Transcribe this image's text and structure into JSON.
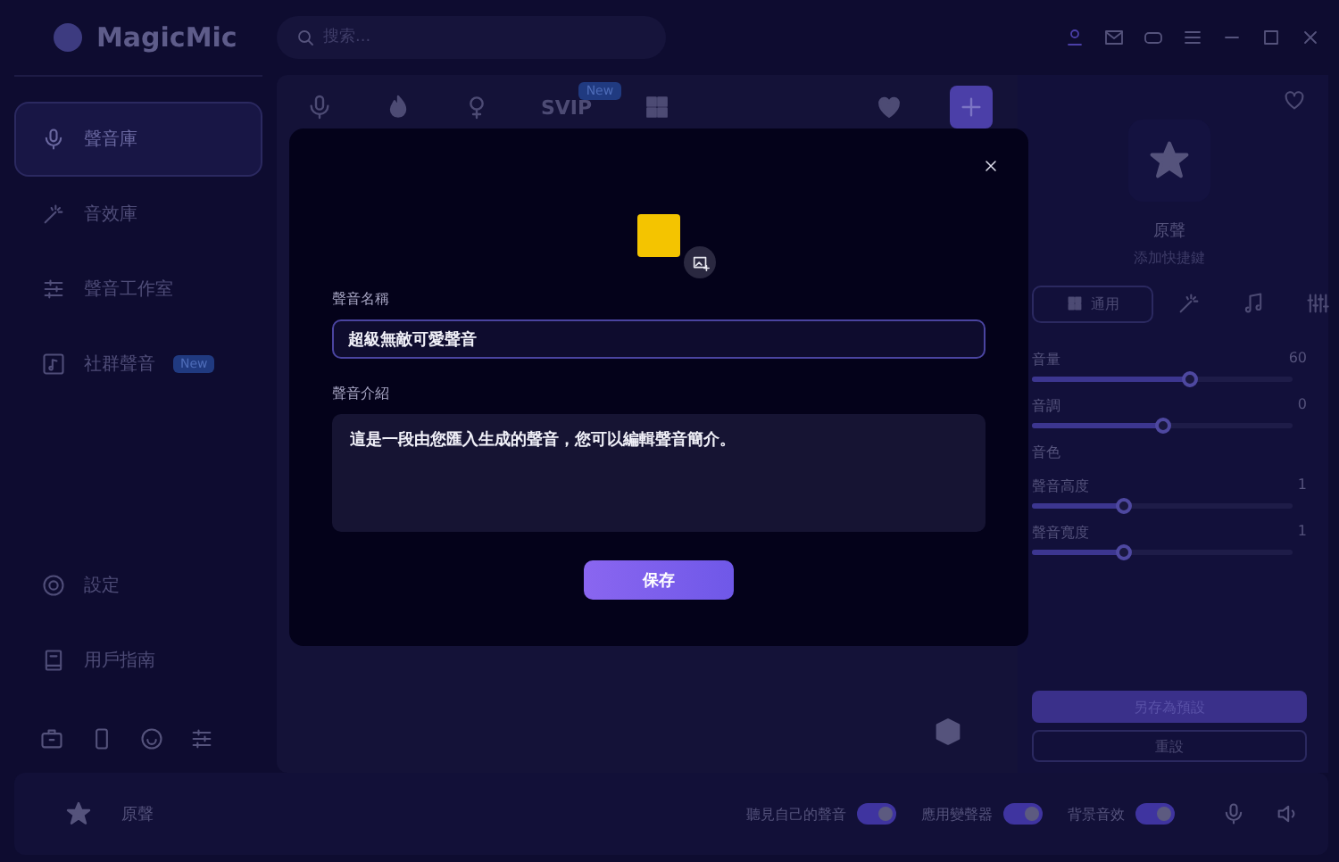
{
  "app": {
    "name": "MagicMic"
  },
  "search": {
    "placeholder": "搜索..."
  },
  "sidebar": {
    "items": [
      {
        "label": "聲音庫",
        "selected": true
      },
      {
        "label": "音效庫",
        "selected": false
      },
      {
        "label": "聲音工作室",
        "selected": false
      },
      {
        "label": "社群聲音",
        "selected": false,
        "badge": "New"
      }
    ],
    "bottom_items": [
      {
        "label": "設定"
      },
      {
        "label": "用戶指南"
      }
    ]
  },
  "category_tabs": [
    {
      "kind": "icon",
      "selected": false
    },
    {
      "kind": "icon",
      "selected": false
    },
    {
      "kind": "icon",
      "selected": false
    },
    {
      "kind": "text",
      "label": "SVIP",
      "badge": "New",
      "selected": false
    },
    {
      "kind": "icon",
      "selected": false
    },
    {
      "kind": "icon",
      "selected": false
    },
    {
      "kind": "icon",
      "selected": true
    }
  ],
  "voice_panel": {
    "name": "原聲",
    "hint": "添加快捷鍵",
    "tabs": [
      {
        "label": "通用",
        "selected": true
      },
      {
        "selected": false
      },
      {
        "selected": false
      },
      {
        "selected": false
      }
    ],
    "sliders": [
      {
        "kind": "slider",
        "label": "音量",
        "reading": "60",
        "level": 0.6
      },
      {
        "kind": "slider",
        "label": "音調",
        "reading": "0",
        "level": 0.5
      },
      {
        "kind": "heading",
        "label": "音色"
      },
      {
        "kind": "slider",
        "label": "聲音高度",
        "reading": "1",
        "level": 0.35
      },
      {
        "kind": "slider",
        "label": "聲音寬度",
        "reading": "1",
        "level": 0.35
      }
    ],
    "buttons": [
      "另存為預設",
      "重設"
    ]
  },
  "bottom_bar": {
    "current_voice": "原聲",
    "toggles": [
      {
        "label": "聽見自己的聲音",
        "on": true
      },
      {
        "label": "應用變聲器",
        "on": true
      },
      {
        "label": "背景音效",
        "on": true
      }
    ]
  },
  "dialog": {
    "name_label": "聲音名稱",
    "name_value": "超級無敵可愛聲音",
    "intro_label": "聲音介紹",
    "intro_value": "這是一段由您匯入生成的聲音，您可以編輯聲音簡介。",
    "save_button": "保存"
  }
}
